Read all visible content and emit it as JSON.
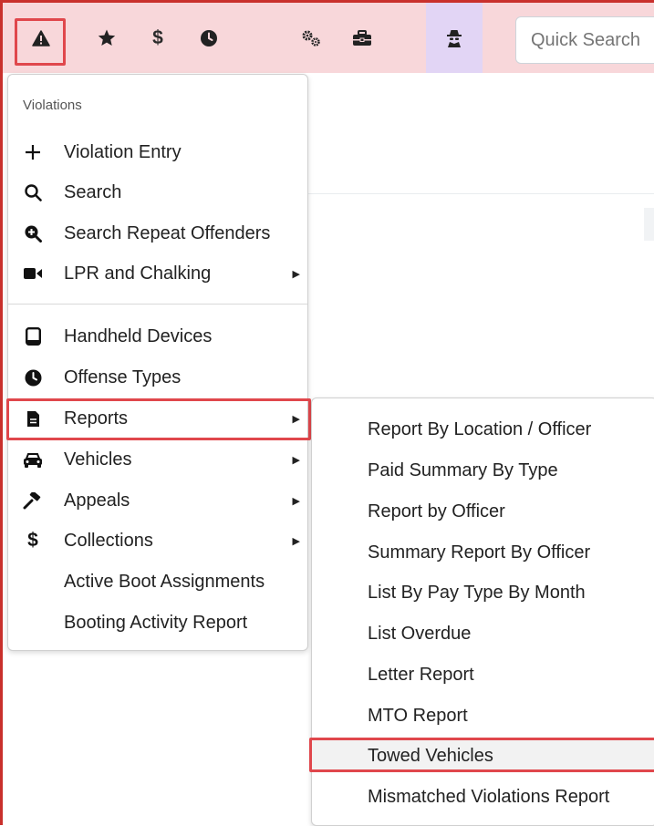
{
  "toolbar": {
    "buttons": [
      {
        "icon": "warning-icon"
      },
      {
        "icon": "star-icon"
      },
      {
        "icon": "dollar-icon"
      },
      {
        "icon": "clock-icon"
      },
      {
        "icon": "gears-icon"
      },
      {
        "icon": "toolbox-icon"
      },
      {
        "icon": "spy-icon"
      }
    ],
    "quick_search_placeholder": "Quick Search"
  },
  "menu": {
    "header": "Violations",
    "items": [
      {
        "label": "Violation Entry",
        "icon": "plus-icon"
      },
      {
        "label": "Search",
        "icon": "search-icon"
      },
      {
        "label": "Search Repeat Offenders",
        "icon": "search-plus-icon"
      },
      {
        "label": "LPR and Chalking",
        "icon": "video-icon"
      },
      {
        "label": "Handheld Devices",
        "icon": "tablet-icon"
      },
      {
        "label": "Offense Types",
        "icon": "clock-icon"
      },
      {
        "label": "Reports",
        "icon": "file-icon"
      },
      {
        "label": "Vehicles",
        "icon": "car-icon"
      },
      {
        "label": "Appeals",
        "icon": "gavel-icon"
      },
      {
        "label": "Collections",
        "icon": "dollar-icon"
      },
      {
        "label": "Active Boot Assignments",
        "icon": ""
      },
      {
        "label": "Booting Activity Report",
        "icon": ""
      }
    ]
  },
  "submenu": {
    "items": [
      "Report By Location / Officer",
      "Paid Summary By Type",
      "Report by Officer",
      "Summary Report By Officer",
      "List By Pay Type By Month",
      "List Overdue",
      "Letter Report",
      "MTO Report",
      "Towed Vehicles",
      "Mismatched Violations Report"
    ]
  },
  "colors": {
    "toolbar_bg": "#f8d7da",
    "active_tab_bg": "#e2d5f5",
    "highlight_border": "#e0474c"
  }
}
